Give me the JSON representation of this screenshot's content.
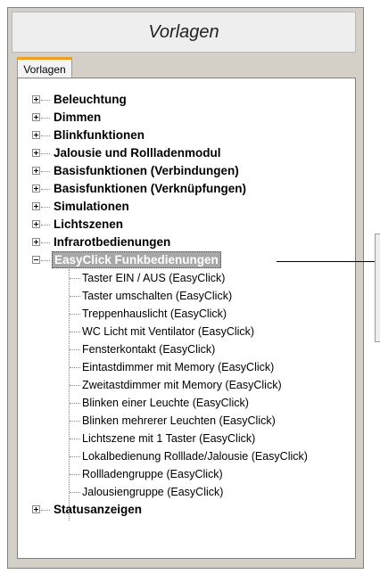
{
  "panel": {
    "title": "Vorlagen"
  },
  "tabs": [
    {
      "label": "Vorlagen"
    }
  ],
  "tree": {
    "nodes_before": [
      {
        "label": "Beleuchtung"
      },
      {
        "label": "Dimmen"
      },
      {
        "label": "Blinkfunktionen"
      },
      {
        "label": "Jalousie und Rollladenmodul"
      },
      {
        "label": "Basisfunktionen (Verbindungen)"
      },
      {
        "label": "Basisfunktionen (Verknüpfungen)"
      },
      {
        "label": "Simulationen"
      },
      {
        "label": "Lichtszenen"
      },
      {
        "label": "Infrarotbedienungen"
      }
    ],
    "expanded": {
      "label": "EasyClick Funkbedienungen",
      "children": [
        "Taster EIN / AUS (EasyClick)",
        "Taster umschalten (EasyClick)",
        "Treppenhauslicht (EasyClick)",
        "WC Licht mit Ventilator (EasyClick)",
        "Fensterkontakt (EasyClick)",
        "Eintastdimmer mit Memory (EasyClick)",
        "Zweitastdimmer mit Memory (EasyClick)",
        "Blinken einer Leuchte (EasyClick)",
        "Blinken mehrerer Leuchten (EasyClick)",
        "Lichtszene mit 1 Taster (EasyClick)",
        "Lokalbedienung Rolllade/Jalousie (EasyClick)",
        "Rollladengruppe (EasyClick)",
        "Jalousiengruppe (EasyClick)"
      ]
    },
    "nodes_after": [
      {
        "label": "Statusanzeigen"
      }
    ]
  }
}
